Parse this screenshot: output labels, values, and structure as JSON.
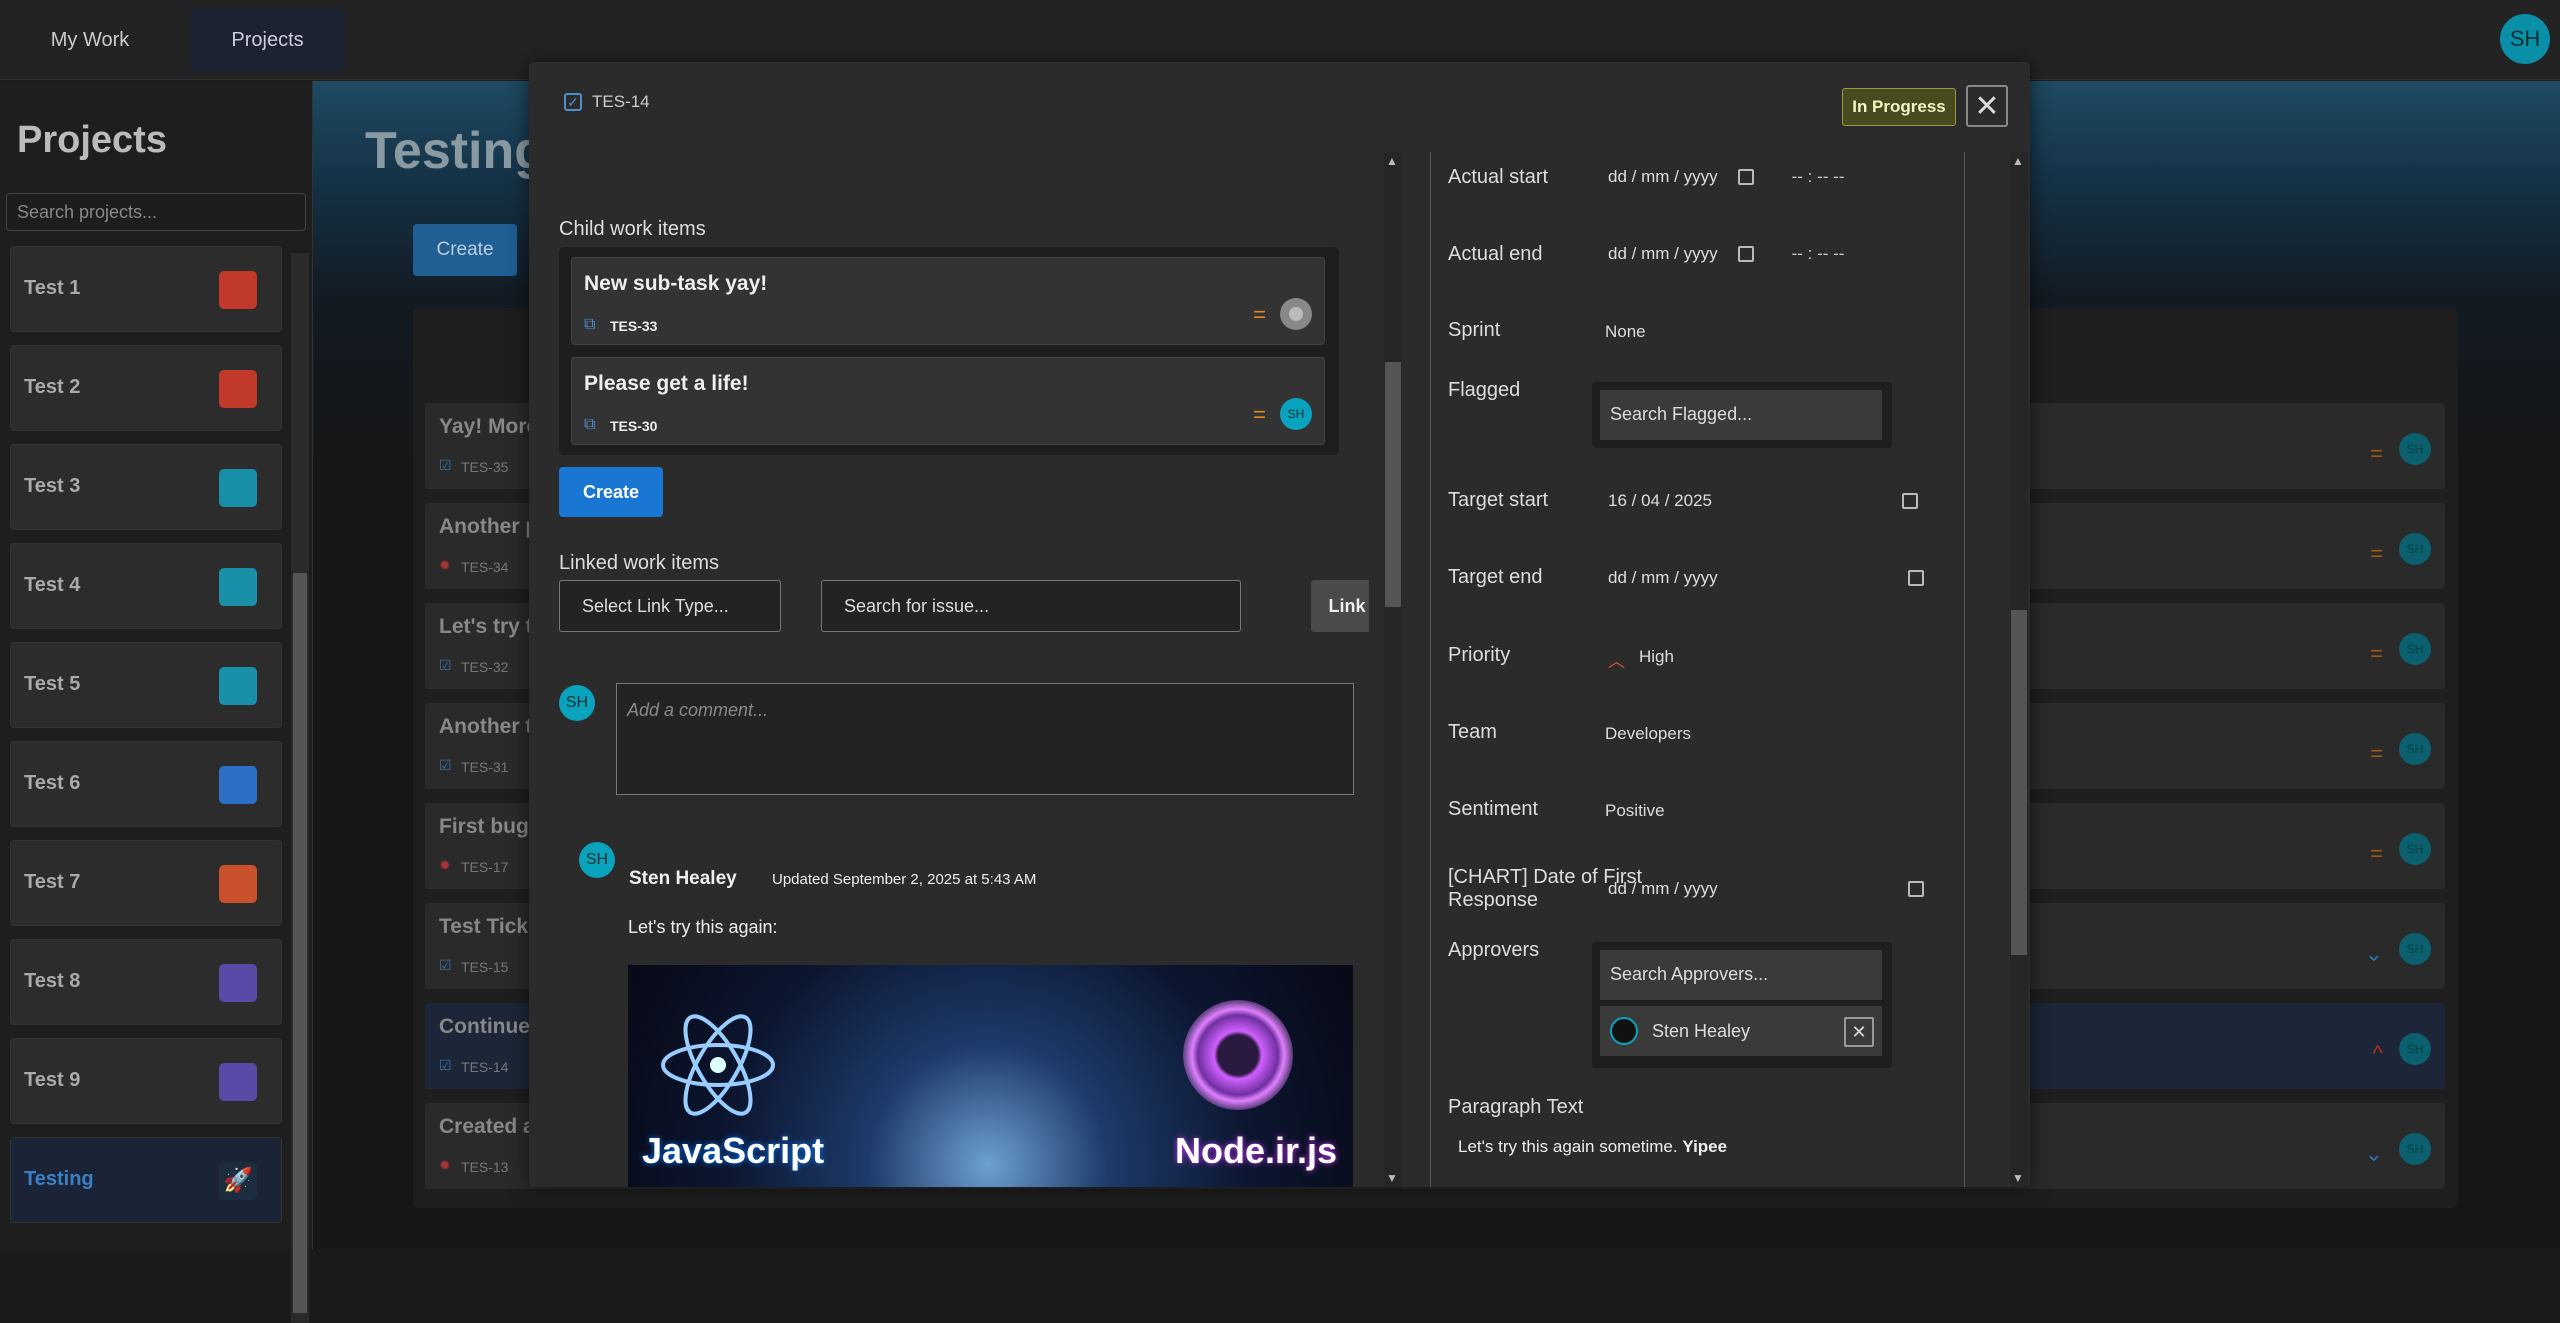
{
  "topbar": {
    "tabs": [
      "My Work",
      "Projects"
    ],
    "avatar": "SH"
  },
  "sidebar": {
    "title": "Projects",
    "search_placeholder": "Search projects...",
    "projects": [
      {
        "name": "Test 1",
        "icon": "red"
      },
      {
        "name": "Test 2",
        "icon": "red"
      },
      {
        "name": "Test 3",
        "icon": "teal"
      },
      {
        "name": "Test 4",
        "icon": "teal"
      },
      {
        "name": "Test 5",
        "icon": "teal"
      },
      {
        "name": "Test 6",
        "icon": "blue"
      },
      {
        "name": "Test 7",
        "icon": "red"
      },
      {
        "name": "Test 8",
        "icon": "purple"
      },
      {
        "name": "Test 9",
        "icon": "purple"
      },
      {
        "name": "Testing",
        "icon": "rocket"
      }
    ]
  },
  "main": {
    "title": "Testing",
    "create": "Create",
    "rows": [
      {
        "title": "Yay! More",
        "key": "TES-35",
        "type": "task",
        "priority": "=",
        "avatar": "SH"
      },
      {
        "title": "Another p",
        "key": "TES-34",
        "type": "bug",
        "priority": "=",
        "avatar": "SH"
      },
      {
        "title": "Let's try t",
        "key": "TES-32",
        "type": "task",
        "priority": "=",
        "avatar": "SH"
      },
      {
        "title": "Another t",
        "key": "TES-31",
        "type": "task",
        "priority": "=",
        "avatar": "SH"
      },
      {
        "title": "First bug",
        "key": "TES-17",
        "type": "bug",
        "priority": "=",
        "avatar": "SH"
      },
      {
        "title": "Test Ticke",
        "key": "TES-15",
        "type": "task",
        "priority": "⌄",
        "avatar": "SH"
      },
      {
        "title": "Continue",
        "key": "TES-14",
        "type": "task",
        "priority": "^",
        "avatar": "SH"
      },
      {
        "title": "Created a",
        "key": "TES-13",
        "type": "bug",
        "priority": "⌄",
        "avatar": "SH"
      }
    ]
  },
  "modal": {
    "key": "TES-14",
    "status": "In Progress",
    "child_label": "Child work items",
    "children": [
      {
        "title": "New sub-task yay!",
        "key": "TES-33",
        "avatar": ""
      },
      {
        "title": "Please get a life!",
        "key": "TES-30",
        "avatar": "SH"
      }
    ],
    "create": "Create",
    "linked_label": "Linked work items",
    "link_type": "Select Link Type...",
    "link_search": "Search for issue...",
    "link_btn": "Link",
    "comment_avatar": "SH",
    "comment_placeholder": "Add a comment...",
    "comment": {
      "avatar": "SH",
      "author": "Sten Healey",
      "updated": "Updated September 2, 2025 at 5:43 AM",
      "text": "Let's try this again:",
      "img_left": "JavaScript",
      "img_right": "Node.ir.js"
    },
    "fields": {
      "actual_start": "Actual start",
      "actual_end": "Actual end",
      "date_ph": "dd / mm / yyyy",
      "time_ph": "-- : --  --",
      "sprint": "Sprint",
      "sprint_val": "None",
      "flagged": "Flagged",
      "flagged_ph": "Search Flagged...",
      "target_start": "Target start",
      "target_start_val": "16 / 04 / 2025",
      "target_end": "Target end",
      "priority": "Priority",
      "priority_val": "High",
      "team": "Team",
      "team_val": "Developers",
      "sentiment": "Sentiment",
      "sentiment_val": "Positive",
      "chart_date": "[CHART] Date of First Response",
      "approvers": "Approvers",
      "approvers_ph": "Search Approvers...",
      "approver": "Sten Healey",
      "paragraph": "Paragraph Text",
      "paragraph_text": "Let's try this again sometime.",
      "paragraph_bold": "Yipee"
    }
  }
}
